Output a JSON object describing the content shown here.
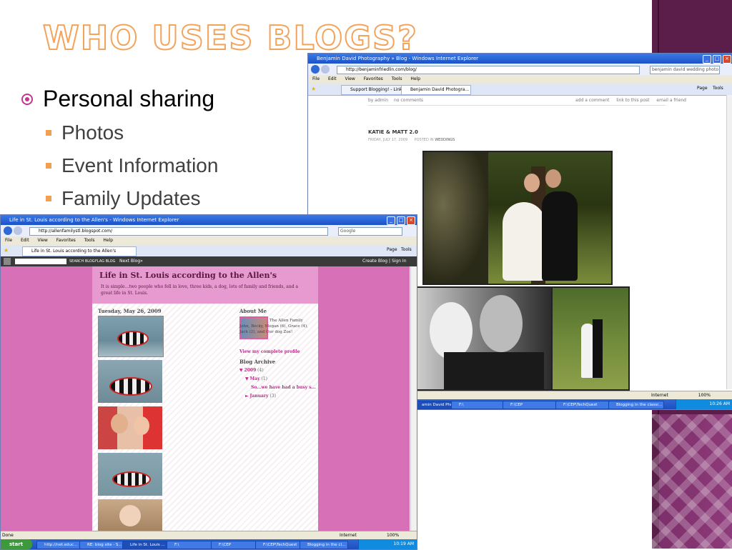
{
  "slide": {
    "title": "WHO USES BLOGS?",
    "bullet_main": "Personal sharing",
    "sub_bullets": [
      "Photos",
      "Event Information",
      "Family Updates"
    ]
  },
  "window_back": {
    "title": "Benjamin David Photography » Blog - Windows Internet Explorer",
    "address": "http://benjaminfriedlin.com/blog/",
    "search": "benjamin david wedding photo blog",
    "menu": [
      "File",
      "Edit",
      "View",
      "Favorites",
      "Tools",
      "Help"
    ],
    "tabs": [
      "Support Blogging! - Links to S...",
      "Benjamin David Photogra..."
    ],
    "toolbar_right": [
      "Page",
      "Tools"
    ],
    "post_meta_left": [
      "by admin",
      "no comments"
    ],
    "post_meta_right": [
      "add a comment",
      "link to this post",
      "email a friend"
    ],
    "post_title": "KATIE & MATT 2.0",
    "post_date": "FRIDAY, JULY 17, 2009",
    "posted_in_label": "POSTED IN",
    "posted_in": "WEDDINGS",
    "status_zone": "Internet",
    "zoom": "100%",
    "taskbar_items": [
      "amin David Phot...",
      "F:\\",
      "F:\\CEP",
      "F:\\CEP\\TechQuest",
      "Blogging in the classr..."
    ],
    "clock": "10:26 AM"
  },
  "window_front": {
    "title": "Life in St. Louis according to the Allen's - Windows Internet Explorer",
    "address": "http://allenfamilystl.blogspot.com/",
    "search": "Google",
    "menu": [
      "File",
      "Edit",
      "View",
      "Favorites",
      "Tools",
      "Help"
    ],
    "tab": "Life in St. Louis according to the Allen's",
    "toolbar_right": [
      "Page",
      "Tools"
    ],
    "nav_search_label": "SEARCH BLOG",
    "nav_flag_label": "FLAG BLOG",
    "nav_next": "Next Blog»",
    "nav_right": "Create Blog | Sign In",
    "blog_title": "Life in St. Louis according to the Allen's",
    "blog_description": "It is simple...two people who fell in love, three kids, a dog, lots of family and friends, and a great life in St. Louis.",
    "post_date": "Tuesday, May 26, 2009",
    "about_heading": "About Me",
    "about_text": "The Allen Family John, Becky, Megan (6), Grace (4), Jack (2), and Our dog Zoe!",
    "profile_link": "View my complete profile",
    "archive_heading": "Blog Archive",
    "archive": [
      {
        "marker": "▼",
        "label": "2009",
        "count": "(4)"
      },
      {
        "marker": "▼",
        "label": "May",
        "count": "(1)"
      },
      {
        "marker": "",
        "label": "So...we have had a busy s...",
        "count": ""
      },
      {
        "marker": "►",
        "label": "January",
        "count": "(3)"
      }
    ],
    "status": "Done",
    "status_zone": "Internet",
    "zoom": "100%",
    "start": "start",
    "taskbar_items": [
      "http://net.educ...",
      "RE: blog site - S...",
      "Life in St. Louis ...",
      "F:\\",
      "F:\\CEP",
      "F:\\CEP\\TechQuest",
      "Blogging in the cl..."
    ],
    "clock": "10:19 AM"
  },
  "colors": {
    "title_outline": "#f4a35b",
    "accent_bullet": "#c2378f",
    "sub_square": "#f0a050",
    "side_strip": "#5a1f49",
    "blog_pink": "#d870b8",
    "ie_blue": "#1c52c8"
  }
}
